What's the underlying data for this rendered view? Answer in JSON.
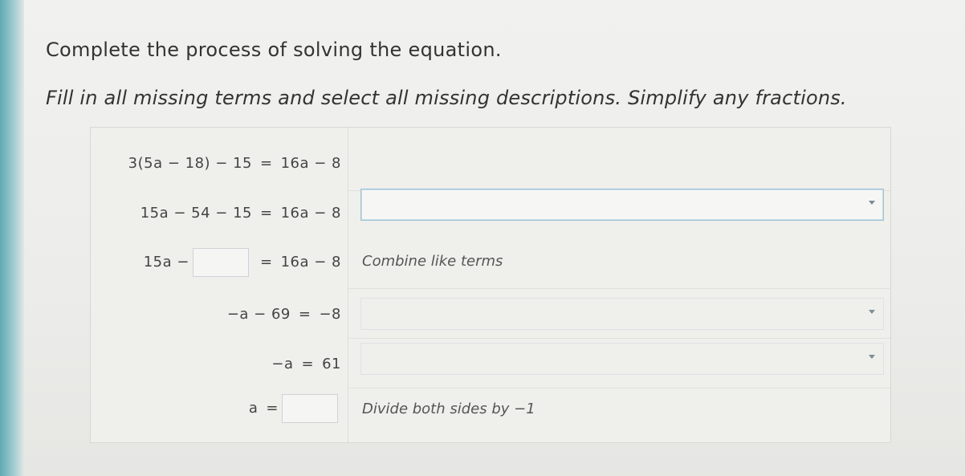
{
  "instructions": {
    "line1": "Complete the process of solving the equation.",
    "line2": "Fill in all missing terms and select all missing descriptions. Simplify any fractions."
  },
  "steps": [
    {
      "left": "3(5a − 18) − 15",
      "eq": "=",
      "right": "16a − 8",
      "description": ""
    },
    {
      "left": "15a − 54 − 15",
      "eq": "=",
      "right": "16a − 8",
      "description_dropdown": ""
    },
    {
      "left_prefix": "15a −",
      "blank": "",
      "eq": "=",
      "right": "16a − 8",
      "description": "Combine like terms"
    },
    {
      "left": "−a − 69",
      "eq": "=",
      "right": "−8",
      "description_dropdown": ""
    },
    {
      "left": "−a",
      "eq": "=",
      "right": "61",
      "description_dropdown": ""
    },
    {
      "left": "a",
      "eq": "=",
      "blank": "",
      "description": "Divide both sides by −1"
    }
  ]
}
